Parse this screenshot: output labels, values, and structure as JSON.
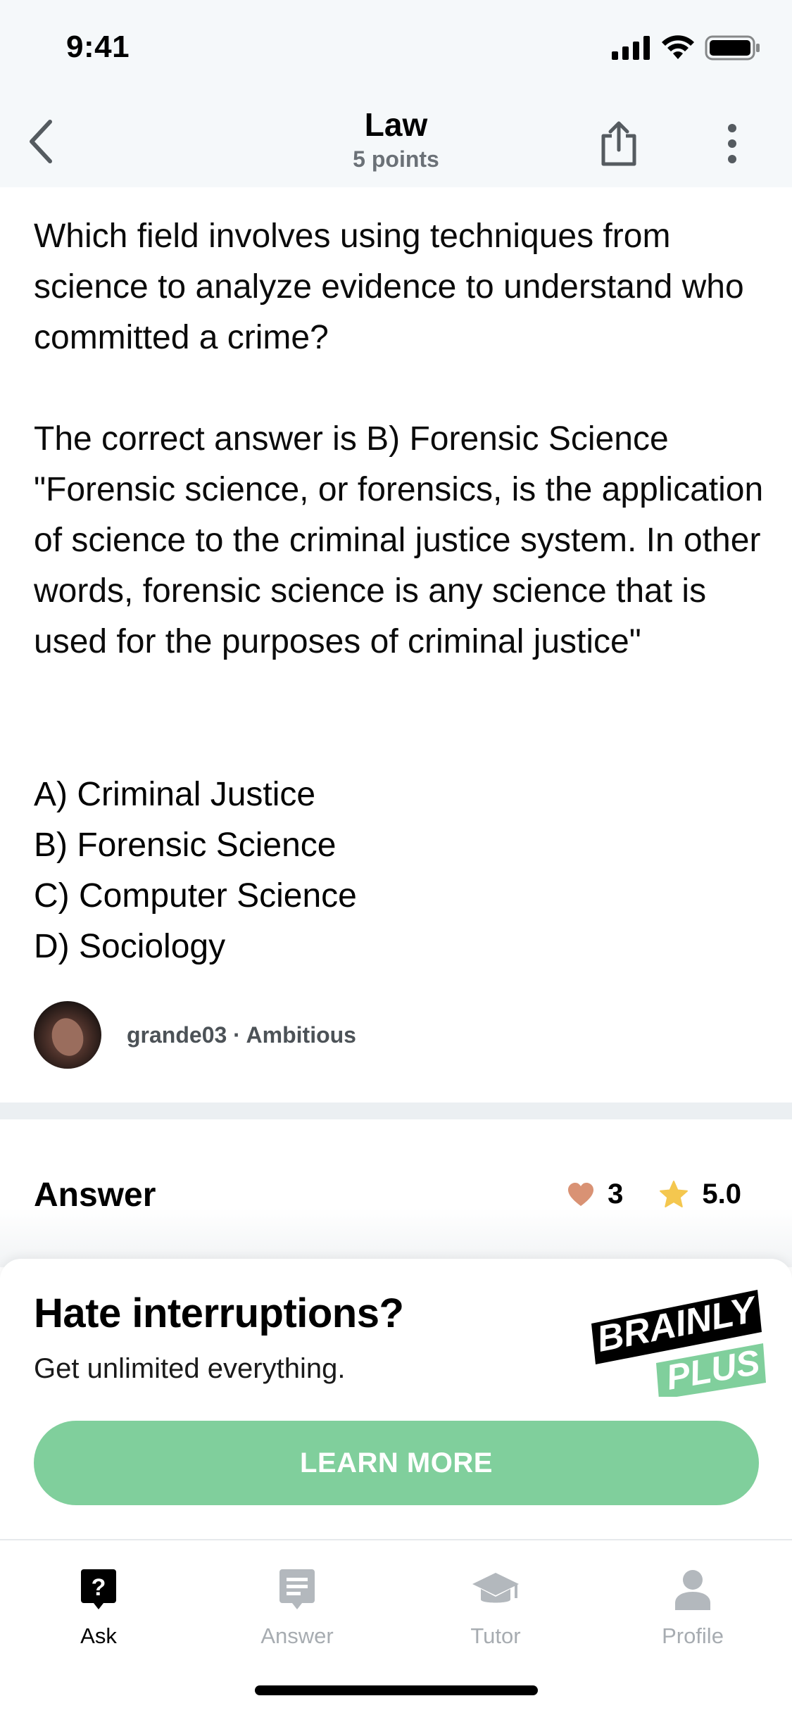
{
  "status_bar": {
    "time": "9:41"
  },
  "header": {
    "title": "Law",
    "subtitle": "5 points"
  },
  "question": {
    "text": "Which field involves using techniques from science to analyze evidence to understand who committed a crime?",
    "explanation": "The correct answer is B) Forensic Science \"Forensic science, or forensics, is the application of science to the criminal justice system. In other words, forensic science is any science that is used for the purposes of criminal justice\"",
    "options": [
      "A) Criminal Justice",
      "B) Forensic Science",
      "C) Computer Science",
      "D) Sociology"
    ],
    "author": "grande03 · Ambitious"
  },
  "answer": {
    "title": "Answer",
    "likes": "3",
    "rating": "5.0"
  },
  "promo": {
    "title": "Hate interruptions?",
    "subtitle": "Get unlimited everything.",
    "brand_top": "BRAINLY",
    "brand_bottom": "PLUS",
    "button": "LEARN MORE",
    "colors": {
      "brand_green": "#80cf9c"
    }
  },
  "tabs": [
    {
      "label": "Ask",
      "icon": "question-bubble-icon",
      "active": true
    },
    {
      "label": "Answer",
      "icon": "note-icon",
      "active": false
    },
    {
      "label": "Tutor",
      "icon": "graduation-cap-icon",
      "active": false
    },
    {
      "label": "Profile",
      "icon": "person-icon",
      "active": false
    }
  ]
}
